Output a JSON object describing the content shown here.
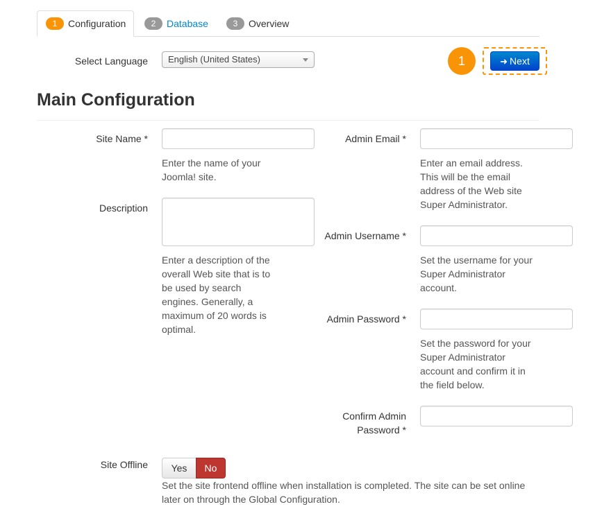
{
  "tabs": [
    {
      "num": "1",
      "label": "Configuration"
    },
    {
      "num": "2",
      "label": "Database"
    },
    {
      "num": "3",
      "label": "Overview"
    }
  ],
  "language": {
    "label": "Select Language",
    "selected": "English (United States)"
  },
  "step_marker": "1",
  "next_button": {
    "label": "Next"
  },
  "heading": "Main Configuration",
  "fields": {
    "site_name": {
      "label": "Site Name *",
      "value": "",
      "help": [
        "Enter the name of your",
        "Joomla! site."
      ]
    },
    "description": {
      "label": "Description",
      "value": "",
      "help": [
        "Enter a description of the",
        "overall Web site that is to",
        "be used by search",
        "engines. Generally, a",
        "maximum of 20 words is",
        "optimal."
      ]
    },
    "admin_email": {
      "label": "Admin Email *",
      "value": "",
      "help": [
        "Enter an email address.",
        "This will be the email",
        "address of the Web site",
        "Super Administrator."
      ]
    },
    "admin_username": {
      "label": "Admin Username *",
      "value": "",
      "help": [
        "Set the username for your",
        "Super Administrator",
        "account."
      ]
    },
    "admin_password": {
      "label": "Admin Password *",
      "value": "",
      "help": [
        "Set the password for your",
        "Super Administrator",
        "account and confirm it in",
        "the field below."
      ]
    },
    "confirm_password": {
      "label_lines": [
        "Confirm Admin",
        "Password *"
      ],
      "value": ""
    }
  },
  "site_offline": {
    "label": "Site Offline",
    "yes": "Yes",
    "no": "No",
    "selected": "No",
    "help": [
      "Set the site frontend offline when installation is completed. The site can be set online",
      "later on through the Global Configuration."
    ]
  },
  "colors": {
    "accent_orange": "#f89406",
    "primary_blue": "#0088cc",
    "danger_red": "#bd362f"
  }
}
